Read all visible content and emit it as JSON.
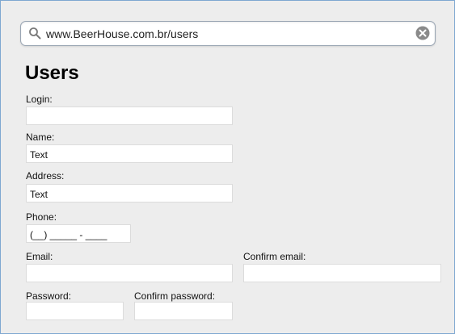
{
  "browser": {
    "url": "www.BeerHouse.com.br/users"
  },
  "page": {
    "title": "Users"
  },
  "form": {
    "login": {
      "label": "Login:",
      "value": ""
    },
    "name": {
      "label": "Name:",
      "value": "Text"
    },
    "address": {
      "label": "Address:",
      "value": "Text"
    },
    "phone": {
      "label": "Phone:",
      "value": "(__) _____ - ____"
    },
    "email": {
      "label": "Email:",
      "value": ""
    },
    "confirm_email": {
      "label": "Confirm email:",
      "value": ""
    },
    "password": {
      "label": "Password:",
      "value": ""
    },
    "confirm_password": {
      "label": "Confirm password:",
      "value": ""
    }
  },
  "icons": {
    "search": "search-icon",
    "clear": "clear-icon"
  },
  "colors": {
    "window_border": "#7fa8d1",
    "background": "#ededed"
  }
}
